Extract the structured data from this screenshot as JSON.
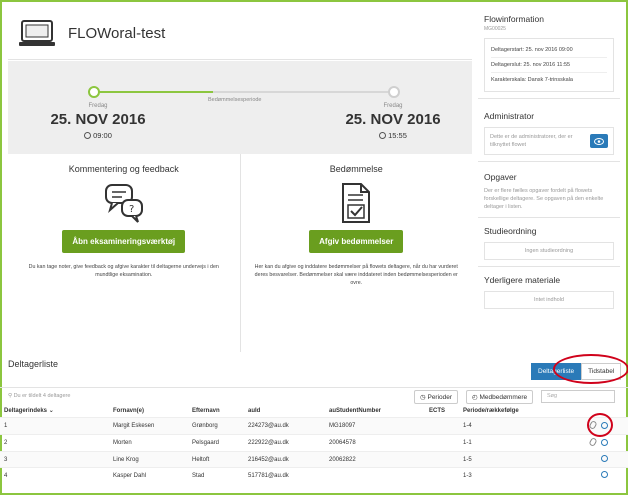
{
  "header": {
    "title": "FLOWoral-test",
    "laptop_icon": "laptop-icon"
  },
  "timeline": {
    "start_day": "Fredag",
    "start_date": "25. NOV 2016",
    "start_time": "09:00",
    "middle_label": "Bedømmelsesperiode",
    "end_day": "Fredag",
    "end_date": "25. NOV 2016",
    "end_time": "15:55"
  },
  "panels": {
    "feedback": {
      "title": "Kommentering og feedback",
      "button": "Åbn eksamineringsværktøj",
      "description": "Du kan tage noter, give feedback og afgive karakter til deltagerne undervejs i den mundtlige eksamination."
    },
    "grading": {
      "title": "Bedømmelse",
      "button": "Afgiv bedømmelser",
      "description": "Her kan du afgive og inddatere bedømmelser på flowets deltagere, når du har vurderet deres besvarelser. Bedømmelser skal være inddateret inden bedømmelsesperioden er ovre."
    }
  },
  "sidebar": {
    "flowinfo_title": "Flowinformation",
    "flowinfo_code": "MG00025",
    "info_lines": [
      "Deltagerstart: 25. nov 2016 09:00",
      "Deltagerslut: 25. nov 2016 11:55",
      "Karakterskala: Dansk 7-trinsskala"
    ],
    "admin_title": "Administrator",
    "admin_text": "Dette er de administratorer, der er tilknyttet flowet",
    "tasks_title": "Opgaver",
    "tasks_text": "Der er flere fælles opgaver fordelt på flowets forskellige deltagere. Se opgaven på den enkelte deltager i listen.",
    "study_title": "Studieordning",
    "study_btn": "Ingen studieordning",
    "more_title": "Yderligere materiale",
    "more_btn": "Intet indhold"
  },
  "participants": {
    "title": "Deltagerliste",
    "view_list": "Deltagerliste",
    "view_time": "Tidstabel",
    "assigned": "Du er tildelt 4 deltagere",
    "btn_periods": "Perioder",
    "btn_graders": "Medbedømmere",
    "search_placeholder": "Søg",
    "columns": [
      "Deltagerindeks",
      "Fornavn(e)",
      "Efternavn",
      "auId",
      "auStudentNumber",
      "ECTS",
      "Periode/rækkefølge"
    ],
    "rows": [
      [
        "1",
        "Margit Eskesen",
        "Grønborg",
        "224273@au.dk",
        "MG18097",
        "",
        "1-4"
      ],
      [
        "2",
        "Morten",
        "Pelsgaard",
        "222922@au.dk",
        "20064578",
        "",
        "1-1"
      ],
      [
        "3",
        "Line Krog",
        "Heltoft",
        "216452@au.dk",
        "20062822",
        "",
        "1-5"
      ],
      [
        "4",
        "Kasper Dahl",
        "Stad",
        "517781@au.dk",
        "",
        "",
        "1-3"
      ]
    ]
  }
}
